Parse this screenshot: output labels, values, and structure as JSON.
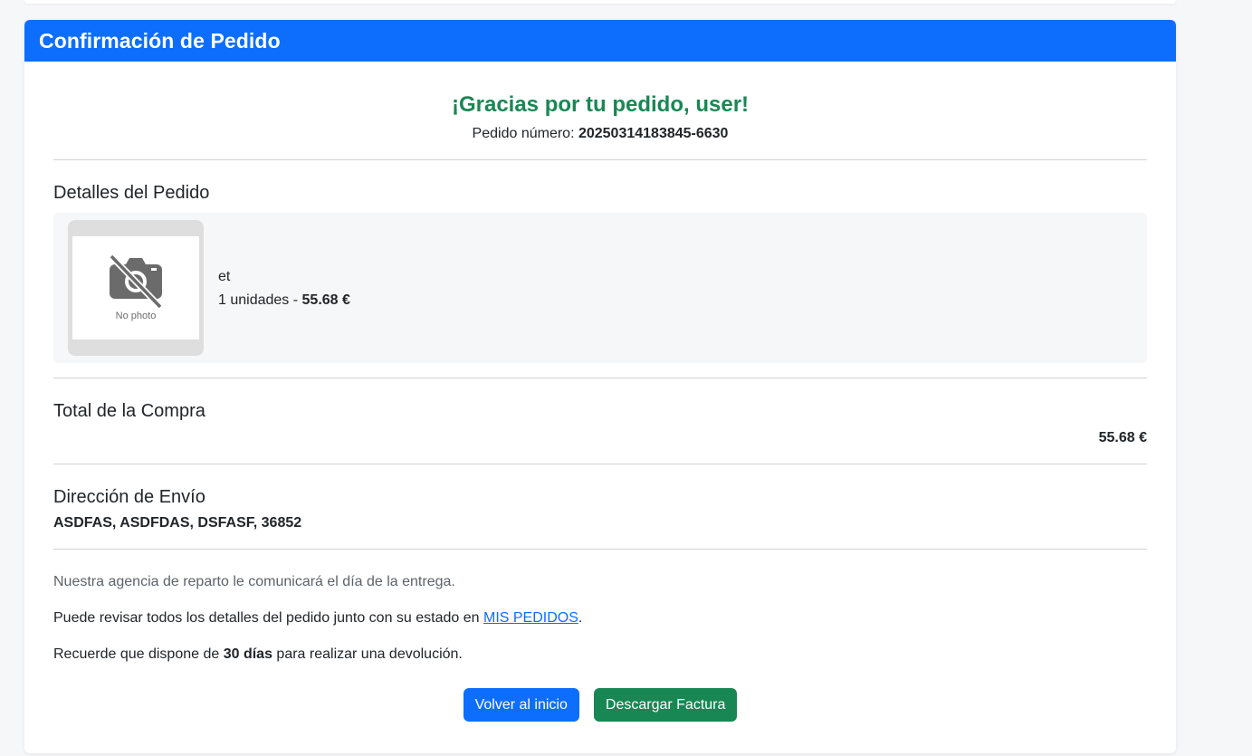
{
  "header": {
    "title": "Confirmación de Pedido"
  },
  "thanks": {
    "message": "¡Gracias por tu pedido, user!",
    "order_label": "Pedido número: ",
    "order_number": "20250314183845-6630"
  },
  "details": {
    "title": "Detalles del Pedido",
    "items": [
      {
        "image_text": "No photo",
        "name": "et",
        "quantity_text": "1 unidades - ",
        "price": "55.68 €"
      }
    ]
  },
  "total": {
    "title": "Total de la Compra",
    "value": "55.68 €"
  },
  "shipping": {
    "title": "Dirección de Envío",
    "address": "ASDFAS, ASDFDAS, DSFASF, 36852"
  },
  "notes": {
    "delivery": "Nuestra agencia de reparto le comunicará el día de la entrega.",
    "review_prefix": "Puede revisar todos los detalles del pedido junto con su estado en ",
    "review_link": "MIS PEDIDOS",
    "review_suffix": ".",
    "return_prefix": "Recuerde que dispone de ",
    "return_days": "30 días",
    "return_suffix": " para realizar una devolución."
  },
  "buttons": {
    "home": "Volver al inicio",
    "invoice": "Descargar Factura"
  },
  "colors": {
    "primary": "#0d6efd",
    "success": "#198754"
  }
}
